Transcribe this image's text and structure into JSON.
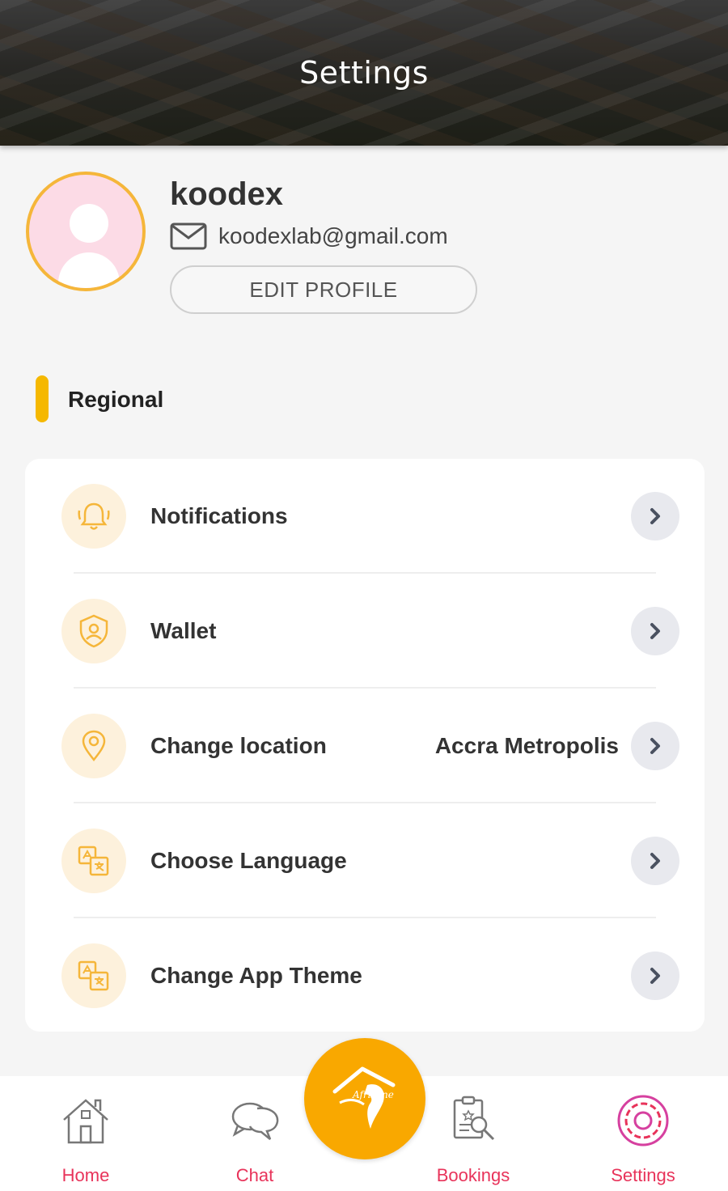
{
  "header": {
    "title": "Settings"
  },
  "profile": {
    "name": "koodex",
    "email": "koodexlab@gmail.com",
    "edit_label": "EDIT PROFILE"
  },
  "section": {
    "title": "Regional"
  },
  "settings": [
    {
      "label": "Notifications",
      "value": "",
      "icon": "bell-icon"
    },
    {
      "label": "Wallet",
      "value": "",
      "icon": "wallet-shield-icon"
    },
    {
      "label": "Change location",
      "value": "Accra Metropolis",
      "icon": "location-pin-icon"
    },
    {
      "label": "Choose Language",
      "value": "",
      "icon": "translate-icon"
    },
    {
      "label": "Change App Theme",
      "value": "",
      "icon": "translate-icon"
    }
  ],
  "nav": {
    "home": "Home",
    "chat": "Chat",
    "bookings": "Bookings",
    "settings": "Settings",
    "center_logo_text": "Afrizone"
  },
  "colors": {
    "accent": "#f5b800",
    "fab": "#f9a800",
    "nav_label": "#e8335a",
    "avatar_bg": "#fcdbe6",
    "icon_bg": "#fdf1dc"
  }
}
